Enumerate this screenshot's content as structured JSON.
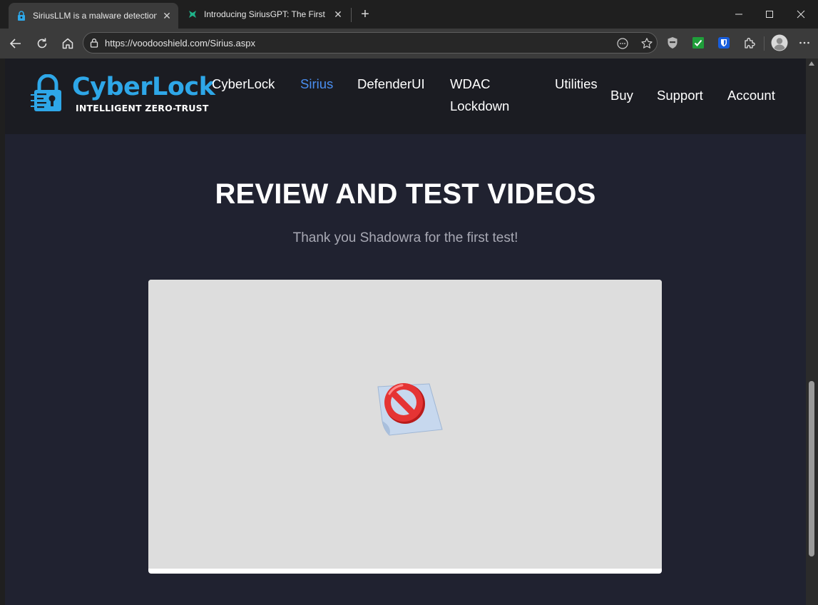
{
  "browser": {
    "tabs": [
      {
        "title": "SiriusLLM is a malware detection e",
        "active": true,
        "favicon": "lock-favicon"
      },
      {
        "title": "Introducing SiriusGPT: The First Re",
        "active": false,
        "favicon": "sirius-favicon"
      }
    ],
    "url": "https://voodooshield.com/Sirius.aspx"
  },
  "site": {
    "logo": {
      "name": "CyberLock",
      "tagline": "INTELLIGENT ZERO-TRUST"
    },
    "nav": [
      {
        "label": "CyberLock",
        "active": false
      },
      {
        "label": "Sirius",
        "active": true
      },
      {
        "label": "DefenderUI",
        "active": false
      },
      {
        "label": "WDAC Lockdown",
        "active": false
      },
      {
        "label": "Utilities",
        "active": false
      },
      {
        "label": "Buy",
        "active": false
      },
      {
        "label": "Support",
        "active": false
      },
      {
        "label": "Account",
        "active": false
      }
    ],
    "heading": "REVIEW AND TEST VIDEOS",
    "subheading": "Thank you Shadowra for the first test!",
    "video": {
      "state": "blocked",
      "icon": "blocked-content-icon"
    }
  },
  "colors": {
    "accent": "#2ea7e8",
    "nav_active": "#4a8ef0",
    "page_bg": "#202230",
    "header_bg": "#1b1c22"
  }
}
